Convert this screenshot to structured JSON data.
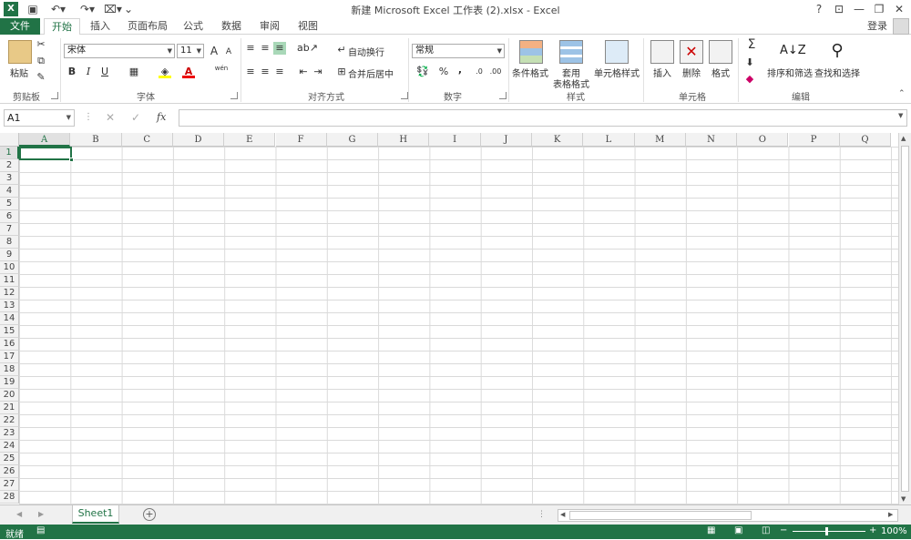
{
  "window": {
    "title": "新建 Microsoft Excel 工作表 (2).xlsx - Excel",
    "controls": [
      "?",
      "⊡",
      "—",
      "❐",
      "✕"
    ],
    "login": "登录"
  },
  "tabs": [
    "文件",
    "开始",
    "插入",
    "页面布局",
    "公式",
    "数据",
    "审阅",
    "视图"
  ],
  "ribbon": {
    "clipboard": {
      "paste": "粘贴",
      "label": "剪贴板"
    },
    "font": {
      "name": "宋体",
      "size": "11",
      "bold": "B",
      "italic": "I",
      "underline": "U",
      "label": "字体",
      "grow": "A",
      "shrink": "A",
      "font_color": "A",
      "phonetic": "wén"
    },
    "alignment": {
      "wrap": "自动换行",
      "merge": "合并后居中",
      "label": "对齐方式"
    },
    "number": {
      "format": "常规",
      "percent": "%",
      "comma": ",",
      "label": "数字"
    },
    "styles": {
      "conditional": "条件格式",
      "table_line1": "套用",
      "table_line2": "表格格式",
      "cell_styles": "单元格样式",
      "label": "样式"
    },
    "cells": {
      "insert": "插入",
      "delete": "删除",
      "format": "格式",
      "label": "单元格"
    },
    "editing": {
      "sort": "排序和筛选",
      "find": "查找和选择",
      "label": "编辑",
      "sigma": "Σ"
    }
  },
  "formula": {
    "namebox": "A1",
    "fx": "fx",
    "cancel": "✕",
    "enter": "✓",
    "value": ""
  },
  "grid": {
    "columns": [
      "A",
      "B",
      "C",
      "D",
      "E",
      "F",
      "G",
      "H",
      "I",
      "J",
      "K",
      "L",
      "M",
      "N",
      "O",
      "P",
      "Q"
    ],
    "rows": [
      "1",
      "2",
      "3",
      "4",
      "5",
      "6",
      "7",
      "8",
      "9",
      "10",
      "11",
      "12",
      "13",
      "14",
      "15",
      "16",
      "17",
      "18",
      "19",
      "20",
      "21",
      "22",
      "23",
      "24",
      "25",
      "26",
      "27",
      "28"
    ],
    "active_cell": "A1"
  },
  "sheets": [
    "Sheet1"
  ],
  "status": {
    "ready": "就绪",
    "zoom": "100%"
  },
  "colors": {
    "accent": "#217346"
  }
}
